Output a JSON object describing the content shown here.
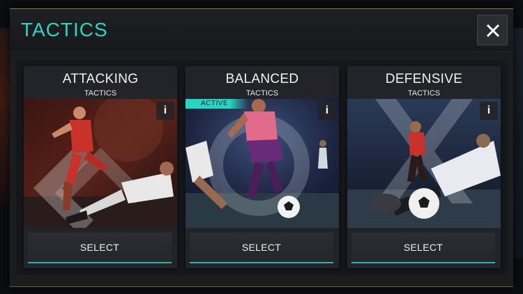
{
  "header": {
    "title": "TACTICS",
    "close_icon": "close-icon"
  },
  "colors": {
    "accent": "#2fd3c3",
    "panel": "#1b1c20",
    "card": "#232429",
    "button": "#2c2d33"
  },
  "cards": [
    {
      "name": "ATTACKING",
      "subtitle": "TACTICS",
      "info": "i",
      "button": "SELECT",
      "active": false
    },
    {
      "name": "BALANCED",
      "subtitle": "TACTICS",
      "info": "i",
      "button": "SELECT",
      "active": true,
      "badge": "ACTIVE"
    },
    {
      "name": "DEFENSIVE",
      "subtitle": "TACTICS",
      "info": "i",
      "button": "SELECT",
      "active": false
    }
  ]
}
